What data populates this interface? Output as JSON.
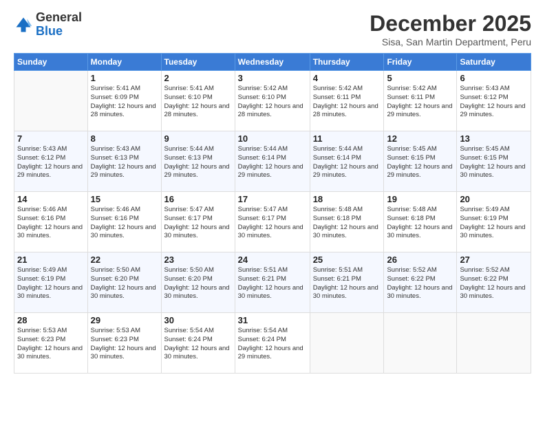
{
  "logo": {
    "general": "General",
    "blue": "Blue"
  },
  "title": "December 2025",
  "subtitle": "Sisa, San Martin Department, Peru",
  "header_days": [
    "Sunday",
    "Monday",
    "Tuesday",
    "Wednesday",
    "Thursday",
    "Friday",
    "Saturday"
  ],
  "weeks": [
    [
      {
        "day": "",
        "sunrise": "",
        "sunset": "",
        "daylight": ""
      },
      {
        "day": "1",
        "sunrise": "Sunrise: 5:41 AM",
        "sunset": "Sunset: 6:09 PM",
        "daylight": "Daylight: 12 hours and 28 minutes."
      },
      {
        "day": "2",
        "sunrise": "Sunrise: 5:41 AM",
        "sunset": "Sunset: 6:10 PM",
        "daylight": "Daylight: 12 hours and 28 minutes."
      },
      {
        "day": "3",
        "sunrise": "Sunrise: 5:42 AM",
        "sunset": "Sunset: 6:10 PM",
        "daylight": "Daylight: 12 hours and 28 minutes."
      },
      {
        "day": "4",
        "sunrise": "Sunrise: 5:42 AM",
        "sunset": "Sunset: 6:11 PM",
        "daylight": "Daylight: 12 hours and 28 minutes."
      },
      {
        "day": "5",
        "sunrise": "Sunrise: 5:42 AM",
        "sunset": "Sunset: 6:11 PM",
        "daylight": "Daylight: 12 hours and 29 minutes."
      },
      {
        "day": "6",
        "sunrise": "Sunrise: 5:43 AM",
        "sunset": "Sunset: 6:12 PM",
        "daylight": "Daylight: 12 hours and 29 minutes."
      }
    ],
    [
      {
        "day": "7",
        "sunrise": "Sunrise: 5:43 AM",
        "sunset": "Sunset: 6:12 PM",
        "daylight": "Daylight: 12 hours and 29 minutes."
      },
      {
        "day": "8",
        "sunrise": "Sunrise: 5:43 AM",
        "sunset": "Sunset: 6:13 PM",
        "daylight": "Daylight: 12 hours and 29 minutes."
      },
      {
        "day": "9",
        "sunrise": "Sunrise: 5:44 AM",
        "sunset": "Sunset: 6:13 PM",
        "daylight": "Daylight: 12 hours and 29 minutes."
      },
      {
        "day": "10",
        "sunrise": "Sunrise: 5:44 AM",
        "sunset": "Sunset: 6:14 PM",
        "daylight": "Daylight: 12 hours and 29 minutes."
      },
      {
        "day": "11",
        "sunrise": "Sunrise: 5:44 AM",
        "sunset": "Sunset: 6:14 PM",
        "daylight": "Daylight: 12 hours and 29 minutes."
      },
      {
        "day": "12",
        "sunrise": "Sunrise: 5:45 AM",
        "sunset": "Sunset: 6:15 PM",
        "daylight": "Daylight: 12 hours and 29 minutes."
      },
      {
        "day": "13",
        "sunrise": "Sunrise: 5:45 AM",
        "sunset": "Sunset: 6:15 PM",
        "daylight": "Daylight: 12 hours and 30 minutes."
      }
    ],
    [
      {
        "day": "14",
        "sunrise": "Sunrise: 5:46 AM",
        "sunset": "Sunset: 6:16 PM",
        "daylight": "Daylight: 12 hours and 30 minutes."
      },
      {
        "day": "15",
        "sunrise": "Sunrise: 5:46 AM",
        "sunset": "Sunset: 6:16 PM",
        "daylight": "Daylight: 12 hours and 30 minutes."
      },
      {
        "day": "16",
        "sunrise": "Sunrise: 5:47 AM",
        "sunset": "Sunset: 6:17 PM",
        "daylight": "Daylight: 12 hours and 30 minutes."
      },
      {
        "day": "17",
        "sunrise": "Sunrise: 5:47 AM",
        "sunset": "Sunset: 6:17 PM",
        "daylight": "Daylight: 12 hours and 30 minutes."
      },
      {
        "day": "18",
        "sunrise": "Sunrise: 5:48 AM",
        "sunset": "Sunset: 6:18 PM",
        "daylight": "Daylight: 12 hours and 30 minutes."
      },
      {
        "day": "19",
        "sunrise": "Sunrise: 5:48 AM",
        "sunset": "Sunset: 6:18 PM",
        "daylight": "Daylight: 12 hours and 30 minutes."
      },
      {
        "day": "20",
        "sunrise": "Sunrise: 5:49 AM",
        "sunset": "Sunset: 6:19 PM",
        "daylight": "Daylight: 12 hours and 30 minutes."
      }
    ],
    [
      {
        "day": "21",
        "sunrise": "Sunrise: 5:49 AM",
        "sunset": "Sunset: 6:19 PM",
        "daylight": "Daylight: 12 hours and 30 minutes."
      },
      {
        "day": "22",
        "sunrise": "Sunrise: 5:50 AM",
        "sunset": "Sunset: 6:20 PM",
        "daylight": "Daylight: 12 hours and 30 minutes."
      },
      {
        "day": "23",
        "sunrise": "Sunrise: 5:50 AM",
        "sunset": "Sunset: 6:20 PM",
        "daylight": "Daylight: 12 hours and 30 minutes."
      },
      {
        "day": "24",
        "sunrise": "Sunrise: 5:51 AM",
        "sunset": "Sunset: 6:21 PM",
        "daylight": "Daylight: 12 hours and 30 minutes."
      },
      {
        "day": "25",
        "sunrise": "Sunrise: 5:51 AM",
        "sunset": "Sunset: 6:21 PM",
        "daylight": "Daylight: 12 hours and 30 minutes."
      },
      {
        "day": "26",
        "sunrise": "Sunrise: 5:52 AM",
        "sunset": "Sunset: 6:22 PM",
        "daylight": "Daylight: 12 hours and 30 minutes."
      },
      {
        "day": "27",
        "sunrise": "Sunrise: 5:52 AM",
        "sunset": "Sunset: 6:22 PM",
        "daylight": "Daylight: 12 hours and 30 minutes."
      }
    ],
    [
      {
        "day": "28",
        "sunrise": "Sunrise: 5:53 AM",
        "sunset": "Sunset: 6:23 PM",
        "daylight": "Daylight: 12 hours and 30 minutes."
      },
      {
        "day": "29",
        "sunrise": "Sunrise: 5:53 AM",
        "sunset": "Sunset: 6:23 PM",
        "daylight": "Daylight: 12 hours and 30 minutes."
      },
      {
        "day": "30",
        "sunrise": "Sunrise: 5:54 AM",
        "sunset": "Sunset: 6:24 PM",
        "daylight": "Daylight: 12 hours and 30 minutes."
      },
      {
        "day": "31",
        "sunrise": "Sunrise: 5:54 AM",
        "sunset": "Sunset: 6:24 PM",
        "daylight": "Daylight: 12 hours and 29 minutes."
      },
      {
        "day": "",
        "sunrise": "",
        "sunset": "",
        "daylight": ""
      },
      {
        "day": "",
        "sunrise": "",
        "sunset": "",
        "daylight": ""
      },
      {
        "day": "",
        "sunrise": "",
        "sunset": "",
        "daylight": ""
      }
    ]
  ]
}
